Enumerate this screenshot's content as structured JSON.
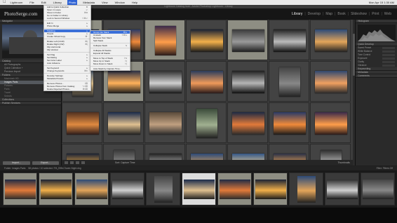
{
  "macmenu": {
    "items": [
      "Lightroom",
      "File",
      "Edit",
      "Library",
      "Photo",
      "Metadata",
      "View",
      "Window",
      "Help"
    ],
    "active_index": 4,
    "right_text": "Mon Apr 15  1:30 AM"
  },
  "window_title": "Lightroom Catalog.lrcat - Adobe Photoshop Lightroom - Library",
  "identity": {
    "logo": "PhotoSerge.com",
    "modules": [
      "Library",
      "Develop",
      "Map",
      "Book",
      "Slideshow",
      "Print",
      "Web"
    ],
    "active_module": "Library"
  },
  "left_panel": {
    "navigator_label": "Navigator",
    "catalog_label": "Catalog",
    "catalog_items": [
      "All Photographs",
      "Quick Collection +",
      "Previous Import"
    ],
    "folders_label": "Folders",
    "folder_items": [
      "Macintosh HD",
      "Pictures",
      "Paris",
      "Travel",
      "Selects"
    ],
    "selected_folder": "Images Paris",
    "collections_label": "Collections",
    "publish_label": "Publish Services",
    "import_btn": "Import...",
    "export_btn": "Export..."
  },
  "right_panel": {
    "histogram_label": "Histogram",
    "quick_develop_label": "Quick Develop",
    "rows": [
      "Saved Preset",
      "White Balance",
      "Tone Control",
      "Exposure",
      "Clarity",
      "Vibrance"
    ],
    "keywording_label": "Keywording",
    "metadata_label": "Metadata",
    "comments_label": "Comments"
  },
  "toolbar": {
    "sort_label": "Sort: Capture Time",
    "thumbnails_label": "Thumbnails"
  },
  "filmstrip_nav": {
    "source_text": "Folder: Images Paris",
    "count_text": "58 photos / 10 selected / PA_Eiffel-Tower-Night.dng",
    "filter_text": "Filter: Filters Off"
  },
  "photo_menu": {
    "items": [
      {
        "label": "Add to Quick Collection",
        "shortcut": "B"
      },
      {
        "label": "Open in Loupe",
        "shortcut": "↵"
      },
      {
        "label": "Show in Finder",
        "shortcut": "⌘R"
      },
      {
        "label": "Go to Folder in Library",
        "shortcut": ""
      },
      {
        "label": "Lock to Second Window",
        "shortcut": "⇧⌘↵"
      },
      {
        "sep": true
      },
      {
        "label": "Edit In",
        "shortcut": "▸"
      },
      {
        "label": "Photo Merge",
        "shortcut": "▸"
      },
      {
        "sep": true
      },
      {
        "label": "Stacking",
        "shortcut": "▸",
        "active": true
      },
      {
        "label": "People",
        "shortcut": "▸"
      },
      {
        "label": "Create Virtual Copy",
        "shortcut": "⌘'"
      },
      {
        "sep": true
      },
      {
        "label": "Rotate Left (CCW)",
        "shortcut": "⌘["
      },
      {
        "label": "Rotate Right (CW)",
        "shortcut": "⌘]"
      },
      {
        "label": "Flip Horizontal",
        "shortcut": ""
      },
      {
        "label": "Flip Vertical",
        "shortcut": ""
      },
      {
        "sep": true
      },
      {
        "label": "Set Flag",
        "shortcut": "▸"
      },
      {
        "label": "Set Rating",
        "shortcut": "▸"
      },
      {
        "label": "Set Color Label",
        "shortcut": "▸"
      },
      {
        "label": "Auto Advance",
        "shortcut": ""
      },
      {
        "sep": true
      },
      {
        "label": "Set Keyword",
        "shortcut": "▸"
      },
      {
        "label": "Change Keywords",
        "shortcut": "⌘K"
      },
      {
        "sep": true
      },
      {
        "label": "Develop Settings",
        "shortcut": "▸"
      },
      {
        "label": "Metadata Presets",
        "shortcut": "▸"
      },
      {
        "sep": true
      },
      {
        "label": "Remove Photos...",
        "shortcut": "⌫"
      },
      {
        "label": "Remove Photos from Catalog",
        "shortcut": "⌥⌫"
      },
      {
        "label": "Delete Rejected Photos...",
        "shortcut": "⌘⌫"
      }
    ]
  },
  "stacking_submenu": {
    "items": [
      {
        "label": "Group into Stack",
        "shortcut": "⌘G",
        "active": true
      },
      {
        "label": "Unstack",
        "shortcut": "⇧⌘G"
      },
      {
        "label": "Remove from Stack",
        "shortcut": ""
      },
      {
        "label": "Split Stack",
        "shortcut": ""
      },
      {
        "sep": true
      },
      {
        "label": "Collapse Stack",
        "shortcut": "S"
      },
      {
        "sep": true
      },
      {
        "label": "Collapse All Stacks",
        "shortcut": ""
      },
      {
        "label": "Expand All Stacks",
        "shortcut": ""
      },
      {
        "sep": true
      },
      {
        "label": "Move to Top of Stack",
        "shortcut": "⇧S"
      },
      {
        "label": "Move Up in Stack",
        "shortcut": "⇧["
      },
      {
        "label": "Move Down in Stack",
        "shortcut": "⇧]"
      },
      {
        "sep": true
      },
      {
        "label": "Auto-Stack by Capture Time...",
        "shortcut": ""
      }
    ]
  },
  "colors": {
    "accent": "#3a6fd8",
    "selected_cell": "#8e8e83",
    "grid_bg": "#3d3d3d"
  }
}
